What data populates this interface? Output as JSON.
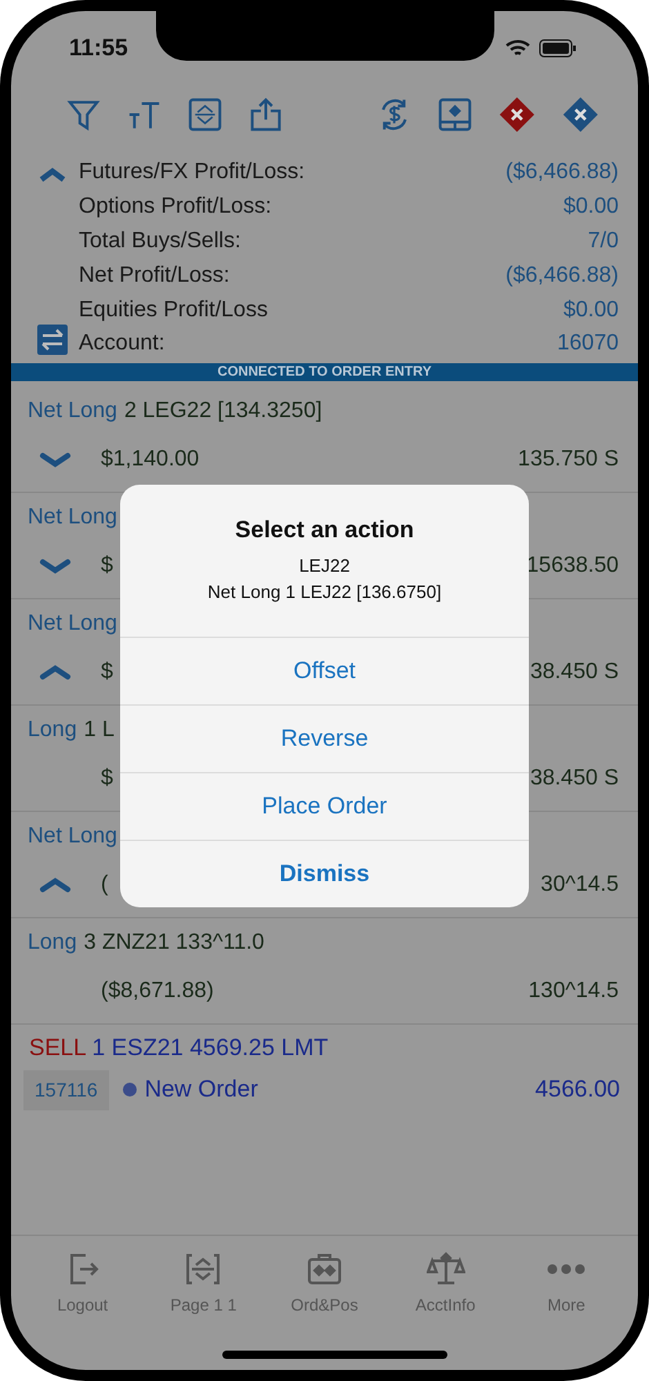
{
  "status_bar": {
    "time": "11:55"
  },
  "summary": {
    "expanded": true,
    "rows": [
      {
        "label": "Futures/FX Profit/Loss:",
        "value": "($6,466.88)"
      },
      {
        "label": "Options Profit/Loss:",
        "value": "$0.00"
      },
      {
        "label": "Total Buys/Sells:",
        "value": "7/0"
      },
      {
        "label": "Net Profit/Loss:",
        "value": "($6,466.88)"
      },
      {
        "label": "Equities Profit/Loss",
        "value": "$0.00"
      },
      {
        "label": "Account:",
        "value": "16070",
        "kind": "account"
      }
    ]
  },
  "banner": "CONNECTED TO ORDER ENTRY",
  "positions": [
    {
      "kind": "net",
      "side": "Net Long",
      "detail": "2 LEG22 [134.3250]",
      "expanded": false,
      "pnl": "$1,140.00",
      "price": "135.750 S"
    },
    {
      "kind": "net",
      "side": "Net Long",
      "expanded": false,
      "pnl": "$",
      "price": "15638.50"
    },
    {
      "kind": "net",
      "side": "Net Long",
      "expanded": true,
      "pnl": "$",
      "price": "38.450 S"
    },
    {
      "kind": "single",
      "side": "Long",
      "detail": "1 L",
      "pnl": "$",
      "price": "38.450 S"
    },
    {
      "kind": "net",
      "side": "Net Long",
      "expanded": true,
      "pnl": "(",
      "price": "30^14.5"
    },
    {
      "kind": "single",
      "side": "Long",
      "detail": "3 ZNZ21 133^11.0",
      "pnl": "($8,671.88)",
      "price": "130^14.5"
    }
  ],
  "order": {
    "side": "SELL",
    "detail": "1 ESZ21 4569.25 LMT",
    "id": "157116",
    "status": "New Order",
    "price": "4566.00"
  },
  "dialog": {
    "title": "Select an action",
    "subtitle": "LEJ22",
    "detail": "Net Long 1 LEJ22 [136.6750]",
    "actions": [
      {
        "label": "Offset",
        "kind": "normal"
      },
      {
        "label": "Reverse",
        "kind": "normal"
      },
      {
        "label": "Place Order",
        "kind": "normal"
      },
      {
        "label": "Dismiss",
        "kind": "cancel"
      }
    ]
  },
  "tabs": [
    {
      "label": "Logout",
      "kind": "logout"
    },
    {
      "label": "Page 1 1",
      "kind": "page"
    },
    {
      "label": "Ord&Pos",
      "kind": "orders"
    },
    {
      "label": "AcctInfo",
      "kind": "account"
    },
    {
      "label": "More",
      "kind": "more"
    }
  ]
}
